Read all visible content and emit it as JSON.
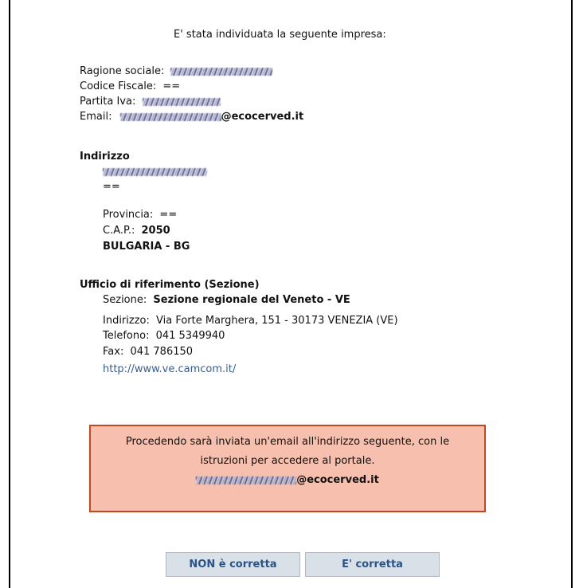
{
  "intro": "E' stata individuata la seguente impresa:",
  "company": {
    "ragione_label": "Ragione sociale:",
    "codice_label": "Codice Fiscale:",
    "codice_value": "==",
    "piva_label": "Partita Iva:",
    "email_label": "Email:",
    "email_domain": "@ecocerved.it"
  },
  "address": {
    "heading": "Indirizzo",
    "line2": "==",
    "provincia_label": "Provincia:",
    "provincia_value": "==",
    "cap_label": "C.A.P.:",
    "cap_value": "2050",
    "country": "BULGARIA - BG"
  },
  "office": {
    "heading": "Ufficio di riferimento (Sezione)",
    "sezione_label": "Sezione:",
    "sezione_value": "Sezione regionale del Veneto - VE",
    "indirizzo_label": "Indirizzo:",
    "indirizzo_value": "Via Forte Marghera, 151 - 30173 VENEZIA (VE)",
    "telefono_label": "Telefono:",
    "telefono_value": "041 5349940",
    "fax_label": "Fax:",
    "fax_value": "041 786150",
    "website": "http://www.ve.camcom.it/"
  },
  "notice": {
    "line1": "Procedendo sarà inviata un'email all'indirizzo seguente, con le",
    "line2": "istruzioni per accedere al portale.",
    "email_domain": "@ecocerved.it"
  },
  "buttons": {
    "not_correct": "NON è corretta",
    "correct": "E' corretta"
  },
  "colors": {
    "notice_bg": "#f6bfae",
    "notice_border": "#c2461e",
    "button_text": "#2a5487",
    "link": "#3a5d8a"
  }
}
